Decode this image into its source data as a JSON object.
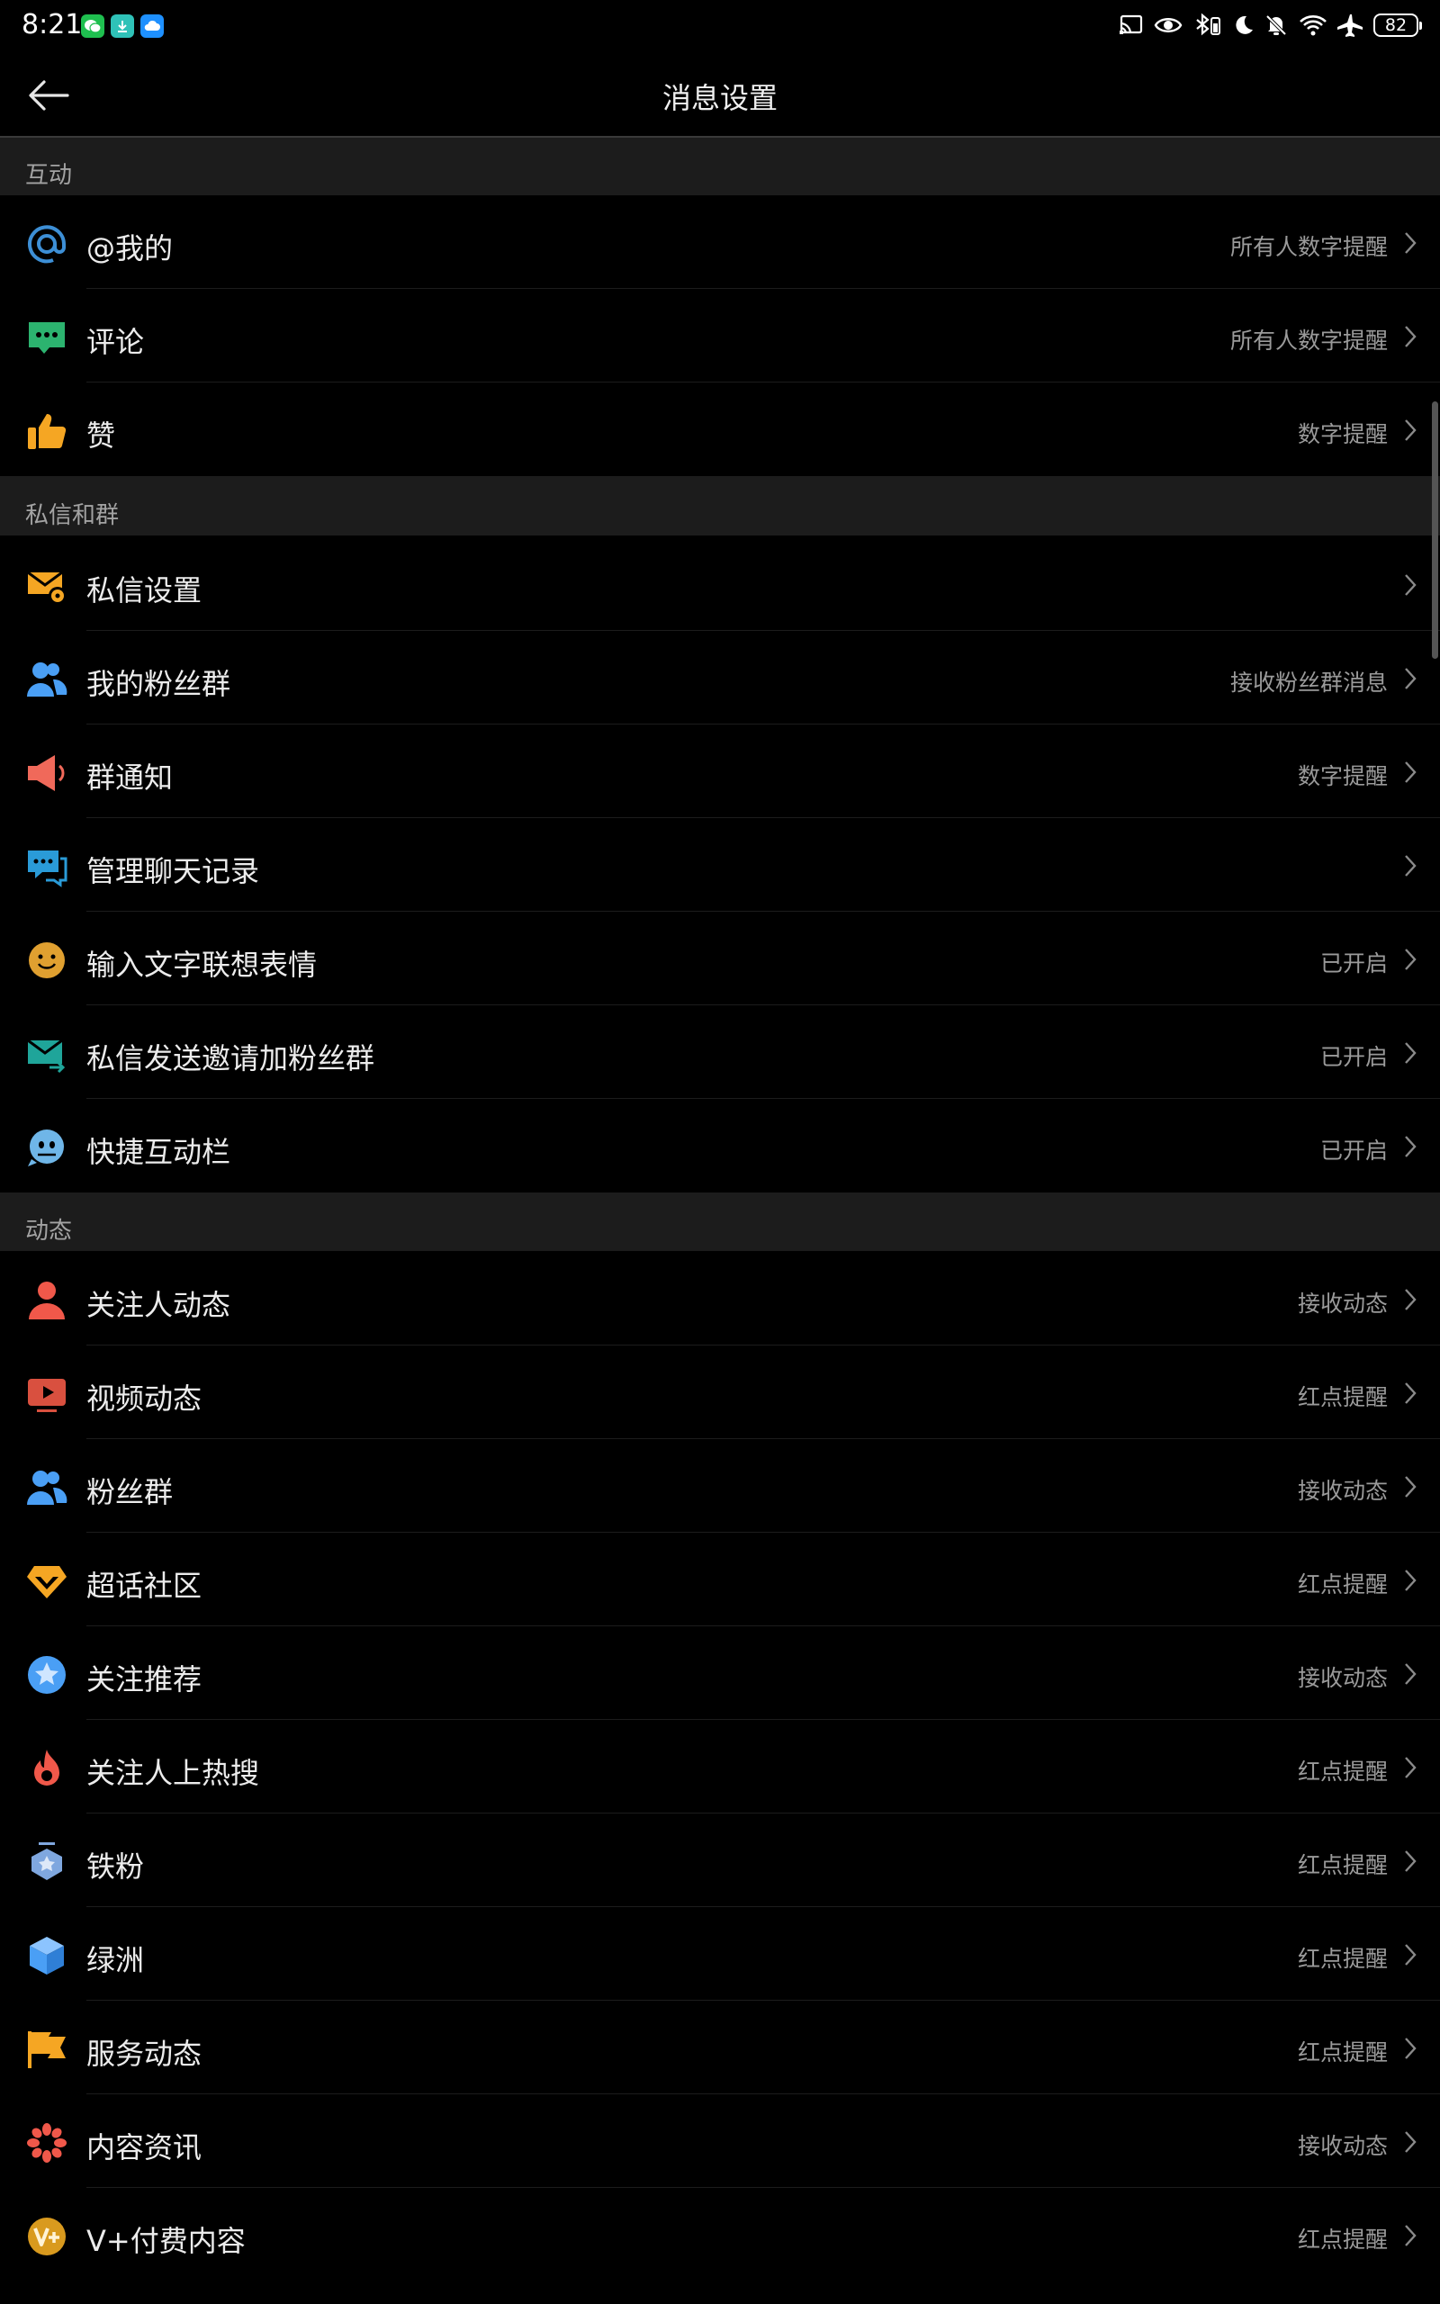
{
  "status_bar": {
    "time": "8:21",
    "battery": "82",
    "app_icons": [
      "wechat-icon",
      "download-icon",
      "cloud-icon"
    ],
    "system_icons": [
      "cast-icon",
      "eye-icon",
      "bluetooth-icon",
      "moon-icon",
      "mute-bell-icon",
      "wifi-icon",
      "airplane-icon",
      "battery-icon"
    ]
  },
  "nav": {
    "title": "消息设置",
    "back_icon": "back-arrow-icon"
  },
  "sections": [
    {
      "title": "互动"
    },
    {
      "title": "私信和群"
    },
    {
      "title": "动态"
    }
  ],
  "rows": [
    {
      "label": "@我的",
      "value": "所有人数字提醒",
      "icon": "at-icon",
      "color": "#3d8fd6"
    },
    {
      "label": "评论",
      "value": "所有人数字提醒",
      "icon": "comment-icon",
      "color": "#2cb36f"
    },
    {
      "label": "赞",
      "value": "数字提醒",
      "icon": "thumbs-up-icon",
      "color": "#f5a623"
    },
    {
      "label": "私信设置",
      "value": "",
      "icon": "mail-settings-icon",
      "color": "#f5a623"
    },
    {
      "label": "我的粉丝群",
      "value": "接收粉丝群消息",
      "icon": "fan-group-icon",
      "color": "#4a9ff5"
    },
    {
      "label": "群通知",
      "value": "数字提醒",
      "icon": "megaphone-icon",
      "color": "#f0695a"
    },
    {
      "label": "管理聊天记录",
      "value": "",
      "icon": "chat-history-icon",
      "color": "#2a9bd8"
    },
    {
      "label": "输入文字联想表情",
      "value": "已开启",
      "icon": "emoji-icon",
      "color": "#e0a030"
    },
    {
      "label": "私信发送邀请加粉丝群",
      "value": "已开启",
      "icon": "mail-invite-icon",
      "color": "#1fa59a"
    },
    {
      "label": "快捷互动栏",
      "value": "已开启",
      "icon": "quick-bar-icon",
      "color": "#6fb6e8"
    },
    {
      "label": "关注人动态",
      "value": "接收动态",
      "icon": "person-icon",
      "color": "#f0584a"
    },
    {
      "label": "视频动态",
      "value": "红点提醒",
      "icon": "video-icon",
      "color": "#d9503f"
    },
    {
      "label": "粉丝群",
      "value": "接收动态",
      "icon": "fan-group-icon",
      "color": "#4a9ff5"
    },
    {
      "label": "超话社区",
      "value": "红点提醒",
      "icon": "diamond-icon",
      "color": "#f5a623"
    },
    {
      "label": "关注推荐",
      "value": "接收动态",
      "icon": "star-badge-icon",
      "color": "#4a9ff5"
    },
    {
      "label": "关注人上热搜",
      "value": "红点提醒",
      "icon": "flame-icon",
      "color": "#f0584a"
    },
    {
      "label": "铁粉",
      "value": "红点提醒",
      "icon": "medal-icon",
      "color": "#7fa7df"
    },
    {
      "label": "绿洲",
      "value": "红点提醒",
      "icon": "cube-icon",
      "color": "#4a9ff5"
    },
    {
      "label": "服务动态",
      "value": "红点提醒",
      "icon": "flag-icon",
      "color": "#f5a623"
    },
    {
      "label": "内容资讯",
      "value": "接收动态",
      "icon": "flower-icon",
      "color": "#f0584a"
    },
    {
      "label": "V+付费内容",
      "value": "红点提醒",
      "icon": "vplus-icon",
      "color": "#d99a1e"
    }
  ]
}
